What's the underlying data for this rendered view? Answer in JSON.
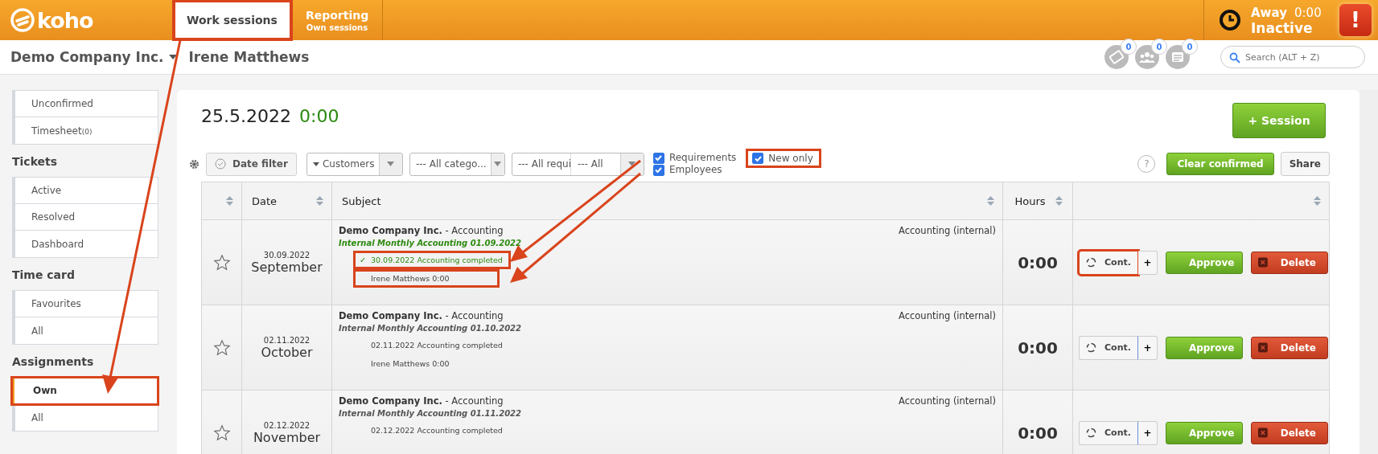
{
  "header": {
    "logo": "koho",
    "tabs": [
      {
        "label": "Work sessions",
        "selected": true,
        "highlighted": true
      },
      {
        "label": "Reporting",
        "sublabel": "Own sessions",
        "selected": false,
        "highlighted": false
      }
    ],
    "status": {
      "state": "Away",
      "time": "0:00",
      "activity": "Inactive"
    },
    "alert": "!"
  },
  "subheader": {
    "company": "Demo Company Inc.",
    "user": "Irene Matthews",
    "counters": [
      {
        "kind": "ticket",
        "count": "0"
      },
      {
        "kind": "people",
        "count": "0"
      },
      {
        "kind": "chat",
        "count": "0"
      }
    ],
    "search": {
      "placeholder": "Search (ALT + Z)"
    }
  },
  "sidebar": [
    {
      "items": [
        {
          "label": "Unconfirmed",
          "selected": false,
          "highlighted": false
        },
        {
          "label": "Timesheet",
          "count": "(0)",
          "selected": false,
          "highlighted": false
        }
      ]
    },
    {
      "title": "Tickets",
      "items": [
        {
          "label": "Active",
          "selected": false,
          "highlighted": false
        },
        {
          "label": "Resolved",
          "selected": false,
          "highlighted": false
        },
        {
          "label": "Dashboard",
          "selected": false,
          "highlighted": false
        }
      ]
    },
    {
      "title": "Time card",
      "items": [
        {
          "label": "Favourites",
          "selected": false,
          "highlighted": false
        },
        {
          "label": "All",
          "selected": false,
          "highlighted": false
        }
      ]
    },
    {
      "title": "Assignments",
      "items": [
        {
          "label": "Own",
          "selected": true,
          "highlighted": true
        },
        {
          "label": "All",
          "selected": false,
          "highlighted": false
        }
      ]
    }
  ],
  "main": {
    "date": "25.5.2022",
    "total": "0:00",
    "new_session": "+ Session",
    "filters": {
      "date_filter": "Date filter",
      "selects": [
        {
          "kind": "caret",
          "label": "Customers"
        },
        {
          "kind": "plain",
          "label": "--- All catego..."
        },
        {
          "kind": "split",
          "label": "--- All requi",
          "second": "--- All"
        }
      ],
      "checkboxes": [
        {
          "label": "Requirements",
          "checked": true
        },
        {
          "label": "Employees",
          "checked": true
        }
      ],
      "new_only": {
        "label": "New only",
        "checked": true,
        "highlighted": true
      },
      "help": "?",
      "clear_confirmed": "Clear confirmed",
      "share": "Share"
    },
    "table": {
      "columns": [
        {
          "kind": "blank"
        },
        {
          "kind": "text",
          "label": "Date"
        },
        {
          "kind": "text",
          "label": "Subject"
        },
        {
          "kind": "text",
          "label": "Hours"
        },
        {
          "kind": "blank"
        }
      ],
      "rows": [
        {
          "favourite": false,
          "day": "30.09.2022",
          "month": "September",
          "company": "Demo Company Inc.",
          "category": "- Accounting",
          "type": "Accounting (internal)",
          "project": "Internal Monthly Accounting 01.09.2022",
          "confirmed": true,
          "requirement": {
            "check": "✓",
            "text": "30.09.2022 Accounting completed",
            "highlighted": true
          },
          "employee": {
            "text": "Irene Matthews 0:00",
            "highlighted": true
          },
          "hours": "0:00",
          "actions": {
            "cont": "Cont.",
            "add": "+",
            "approve": "Approve",
            "delete": "Delete",
            "highlighted": true
          }
        },
        {
          "favourite": false,
          "day": "02.11.2022",
          "month": "October",
          "company": "Demo Company Inc.",
          "category": "- Accounting",
          "type": "Accounting (internal)",
          "project": "Internal Monthly Accounting 01.10.2022",
          "confirmed": false,
          "requirement": {
            "text": "02.11.2022 Accounting completed",
            "highlighted": false
          },
          "employee": {
            "text": "Irene Matthews 0:00",
            "highlighted": false
          },
          "hours": "0:00",
          "actions": {
            "cont": "Cont.",
            "add": "+",
            "approve": "Approve",
            "delete": "Delete",
            "highlighted": false
          }
        },
        {
          "favourite": false,
          "day": "02.12.2022",
          "month": "November",
          "company": "Demo Company Inc.",
          "category": "- Accounting",
          "type": "Accounting (internal)",
          "project": "Internal Monthly Accounting 01.11.2022",
          "confirmed": false,
          "requirement": {
            "text": "02.12.2022 Accounting completed",
            "highlighted": false
          },
          "hours": "0:00",
          "actions": {
            "cont": "Cont.",
            "add": "+",
            "approve": "Approve",
            "delete": "Delete",
            "highlighted": false
          }
        }
      ]
    }
  }
}
